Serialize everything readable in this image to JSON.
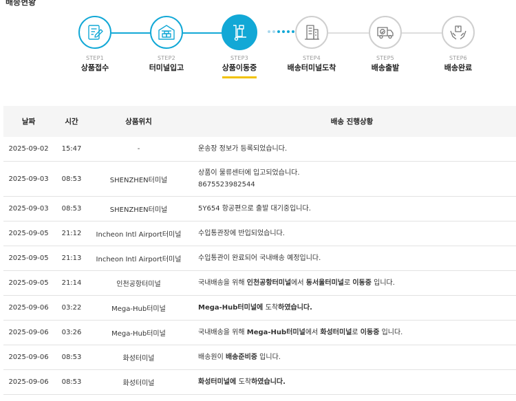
{
  "page_heading": "배송현황",
  "steps": [
    {
      "no": "STEP1",
      "label": "상품접수",
      "state": "done",
      "icon": "document-pen-icon"
    },
    {
      "no": "STEP2",
      "label": "터미널입고",
      "state": "done",
      "icon": "warehouse-icon"
    },
    {
      "no": "STEP3",
      "label": "상품이동중",
      "state": "current",
      "icon": "hand-truck-icon"
    },
    {
      "no": "STEP4",
      "label": "배송터미널도착",
      "state": "todo",
      "icon": "building-icon"
    },
    {
      "no": "STEP5",
      "label": "배송출발",
      "state": "todo",
      "icon": "delivery-truck-icon"
    },
    {
      "no": "STEP6",
      "label": "배송완료",
      "state": "todo",
      "icon": "hands-package-icon"
    }
  ],
  "colors": {
    "accent": "#12a8d6",
    "underline": "#f2c200",
    "inactive": "#cfcfcf"
  },
  "table": {
    "headers": {
      "date": "날짜",
      "time": "시간",
      "location": "상품위치",
      "status": "배송 진행상황"
    },
    "rows": [
      {
        "date": "2025-09-02",
        "time": "15:47",
        "location": "-",
        "status": "운송장 정보가 등록되었습니다."
      },
      {
        "date": "2025-09-03",
        "time": "08:53",
        "location": "SHENZHEN터미널",
        "status": "상품이 물류센터에 입고되었습니다.",
        "tracking_no": "8675523982544"
      },
      {
        "date": "2025-09-03",
        "time": "08:53",
        "location": "SHENZHEN터미널",
        "status": "5Y654 항공편으로 출발 대기중입니다."
      },
      {
        "date": "2025-09-05",
        "time": "21:12",
        "location": "Incheon Intl Airport터미널",
        "status": "수입통관장에 반입되었습니다."
      },
      {
        "date": "2025-09-05",
        "time": "21:13",
        "location": "Incheon Intl Airport터미널",
        "status": "수입통관이 완료되어 국내배송 예정입니다."
      },
      {
        "date": "2025-09-05",
        "time": "21:14",
        "location": "인천공항터미널",
        "status_parts": [
          "국내배송을 위해 ",
          "인천공항터미널",
          "에서 ",
          "동서울터미널",
          "로 ",
          "이동중",
          " 입니다."
        ]
      },
      {
        "date": "2025-09-06",
        "time": "03:22",
        "location": "Mega-Hub터미널",
        "status_parts": [
          "Mega-Hub터미널",
          "에 ",
          "도착",
          "하였습니다."
        ]
      },
      {
        "date": "2025-09-06",
        "time": "03:26",
        "location": "Mega-Hub터미널",
        "status_parts": [
          "국내배송을 위해 ",
          "Mega-Hub터미널",
          "에서 ",
          "화성터미널",
          "로 ",
          "이동중",
          " 입니다."
        ]
      },
      {
        "date": "2025-09-06",
        "time": "08:53",
        "location": "화성터미널",
        "status_parts": [
          "배송원이 ",
          "배송준비중",
          " 입니다."
        ]
      },
      {
        "date": "2025-09-06",
        "time": "08:53",
        "location": "화성터미널",
        "status_parts": [
          "화성터미널",
          "에 ",
          "도착",
          "하였습니다."
        ]
      }
    ]
  }
}
